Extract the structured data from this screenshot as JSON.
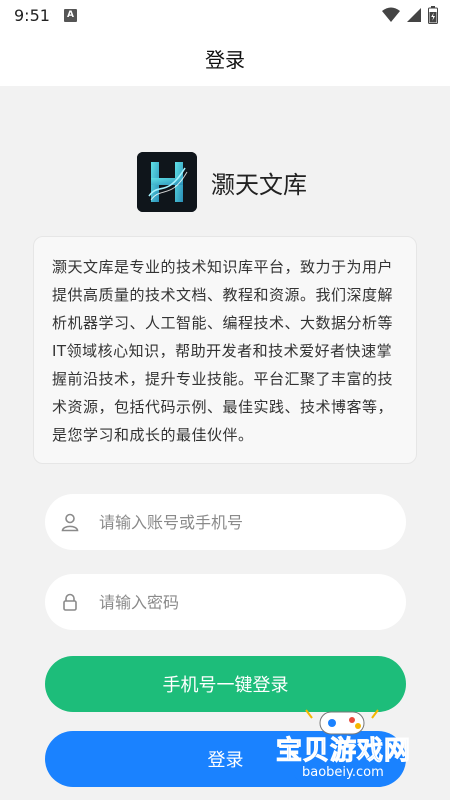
{
  "status_bar": {
    "time": "9:51",
    "notification_badge": "A",
    "icons": [
      "wifi-icon",
      "signal-icon",
      "battery-icon"
    ]
  },
  "nav": {
    "title": "登录"
  },
  "brand": {
    "logo_letter": "H",
    "name": "灏天文库"
  },
  "description": "灏天文库是专业的技术知识库平台，致力于为用户提供高质量的技术文档、教程和资源。我们深度解析机器学习、人工智能、编程技术、大数据分析等IT领域核心知识，帮助开发者和技术爱好者快速掌握前沿技术，提升专业技能。平台汇聚了丰富的技术资源，包括代码示例、最佳实践、技术博客等，是您学习和成长的最佳伙伴。",
  "form": {
    "account_placeholder": "请输入账号或手机号",
    "password_placeholder": "请输入密码",
    "one_click_login_label": "手机号一键登录",
    "login_label": "登录"
  },
  "watermark": {
    "title": "宝贝游戏网",
    "url": "baobeiy.com"
  },
  "colors": {
    "green_button": "#1dbd7a",
    "blue_button": "#1a82ff",
    "background": "#f2f2f2"
  }
}
